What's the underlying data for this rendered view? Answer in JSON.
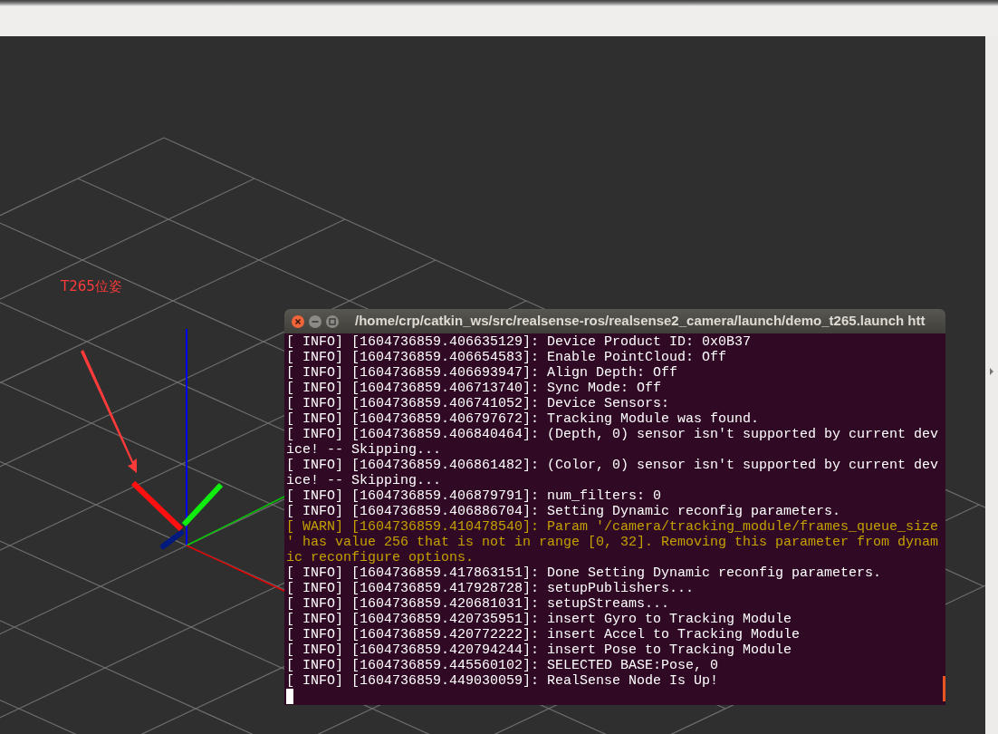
{
  "viewport": {
    "annotation": "T265位姿"
  },
  "terminal": {
    "title": "/home/crp/catkin_ws/src/realsense-ros/realsense2_camera/launch/demo_t265.launch htt",
    "lines": [
      {
        "kind": "info",
        "text": "[ INFO] [1604736859.406635129]: Device Product ID: 0x0B37"
      },
      {
        "kind": "info",
        "text": "[ INFO] [1604736859.406654583]: Enable PointCloud: Off"
      },
      {
        "kind": "info",
        "text": "[ INFO] [1604736859.406693947]: Align Depth: Off"
      },
      {
        "kind": "info",
        "text": "[ INFO] [1604736859.406713740]: Sync Mode: Off"
      },
      {
        "kind": "info",
        "text": "[ INFO] [1604736859.406741052]: Device Sensors:"
      },
      {
        "kind": "info",
        "text": "[ INFO] [1604736859.406797672]: Tracking Module was found."
      },
      {
        "kind": "info",
        "text": "[ INFO] [1604736859.406840464]: (Depth, 0) sensor isn't supported by current device! -- Skipping..."
      },
      {
        "kind": "info",
        "text": "[ INFO] [1604736859.406861482]: (Color, 0) sensor isn't supported by current device! -- Skipping..."
      },
      {
        "kind": "info",
        "text": "[ INFO] [1604736859.406879791]: num_filters: 0"
      },
      {
        "kind": "info",
        "text": "[ INFO] [1604736859.406886704]: Setting Dynamic reconfig parameters."
      },
      {
        "kind": "warn",
        "text": "[ WARN] [1604736859.410478540]: Param '/camera/tracking_module/frames_queue_size' has value 256 that is not in range [0, 32]. Removing this parameter from dynamic reconfigure options."
      },
      {
        "kind": "info",
        "text": "[ INFO] [1604736859.417863151]: Done Setting Dynamic reconfig parameters."
      },
      {
        "kind": "info",
        "text": "[ INFO] [1604736859.417928728]: setupPublishers..."
      },
      {
        "kind": "info",
        "text": "[ INFO] [1604736859.420681031]: setupStreams..."
      },
      {
        "kind": "info",
        "text": "[ INFO] [1604736859.420735951]: insert Gyro to Tracking Module"
      },
      {
        "kind": "info",
        "text": "[ INFO] [1604736859.420772222]: insert Accel to Tracking Module"
      },
      {
        "kind": "info",
        "text": "[ INFO] [1604736859.420794244]: insert Pose to Tracking Module"
      },
      {
        "kind": "info",
        "text": "[ INFO] [1604736859.445560102]: SELECTED BASE:Pose, 0"
      },
      {
        "kind": "info",
        "text": "[ INFO] [1604736859.449030059]: RealSense Node Is Up!"
      }
    ],
    "cursor": true
  }
}
